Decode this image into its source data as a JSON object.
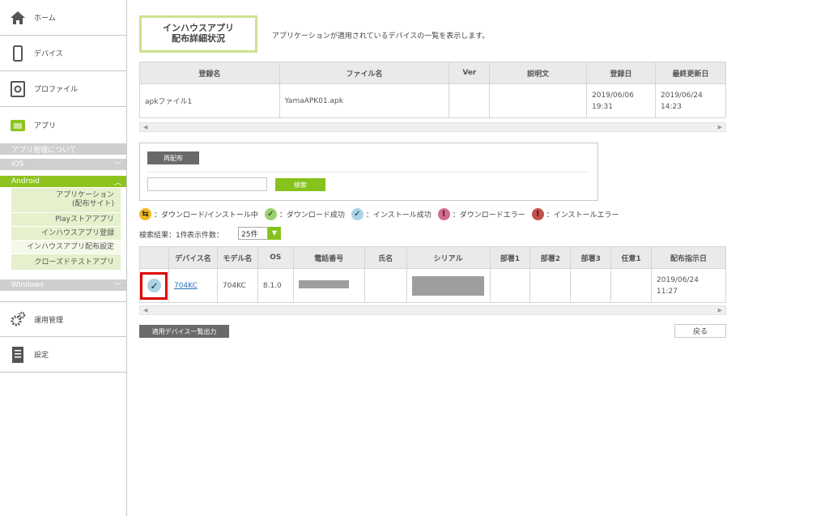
{
  "sidebar": {
    "home": "ホーム",
    "device": "デバイス",
    "profile": "プロファイル",
    "app": "アプリ",
    "app_admin": "アプリ管理について",
    "ios": "iOS",
    "android": "Android",
    "sub_items": [
      "アプリケーション\n(配布サイト)",
      "Playストアアプリ",
      "インハウスアプリ登録",
      "インハウスアプリ配布設定",
      "クローズドテストアプリ"
    ],
    "windows": "Windows",
    "operation": "運用管理",
    "settings": "設定"
  },
  "page": {
    "title_line1": "インハウスアプリ",
    "title_line2": "配布詳細状況",
    "description": "アプリケーションが適用されているデバイスの一覧を表示します。"
  },
  "app_table": {
    "headers": [
      "登録名",
      "ファイル名",
      "Ver",
      "説明文",
      "登録日",
      "最終更新日"
    ],
    "row": [
      "apkファイル1",
      "YamaAPK01.apk",
      "",
      "",
      "2019/06/06\n19:31",
      "2019/06/24\n14:23"
    ]
  },
  "redistribute": {
    "button": "再配布",
    "search_placeholder": "",
    "search_button": "検索"
  },
  "legend": {
    "downloading": "：ダウンロード/インストール中",
    "download_success": "：ダウンロード成功",
    "install_success": "：インストール成功",
    "download_error": "：ダウンロードエラー",
    "install_error": "：インストールエラー"
  },
  "results": {
    "count": "検索結果：1件",
    "per_page_label": "表示件数：",
    "per_page_value": "25件"
  },
  "device_table": {
    "headers": [
      "",
      "デバイス名",
      "モデル名",
      "OS",
      "電話番号",
      "氏名",
      "シリアル",
      "部署1",
      "部署2",
      "部署3",
      "任意1",
      "配布指示日"
    ],
    "row": {
      "device_name": "704KC",
      "model": "704KC",
      "os": "8.1.0",
      "date": "2019/06/24\n11:27"
    }
  },
  "buttons": {
    "export": "適用デバイス一覧出力",
    "back": "戻る"
  },
  "colors": {
    "accent": "#86c21c",
    "status_success": "#a8d4e6",
    "status_progress": "#f0b820",
    "status_error": "#d56a8a",
    "highlight": "#e00000"
  }
}
